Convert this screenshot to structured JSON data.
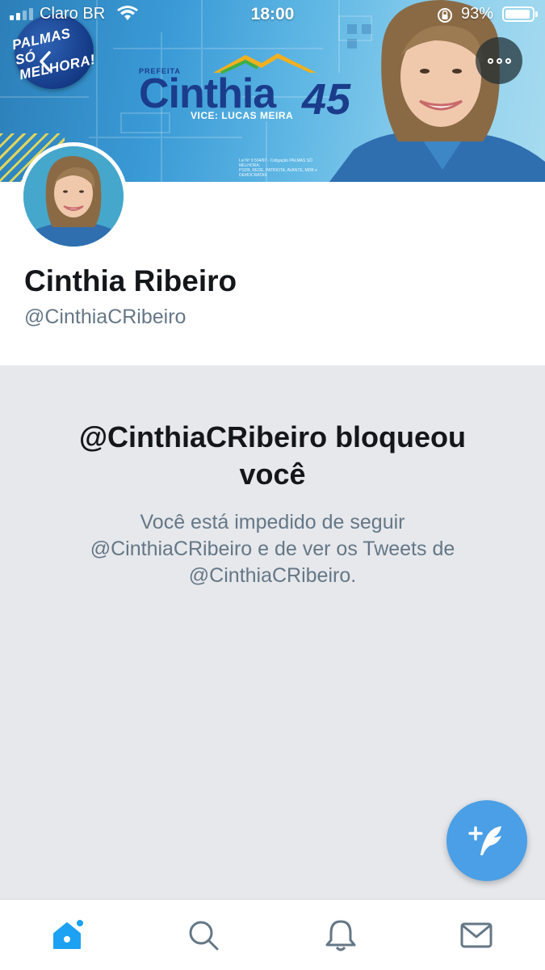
{
  "status_bar": {
    "carrier": "Claro BR",
    "time": "18:00",
    "battery_percent": "93%",
    "battery_level": 0.93
  },
  "banner": {
    "campaign_badge_line1": "PALMAS SÓ",
    "campaign_badge_line2": "MELHORA!",
    "logo_prefix": "PREFEITA",
    "logo_name": "Cinthia",
    "logo_number": "45",
    "logo_vice": "VICE: LUCAS MEIRA",
    "legal_line1": "Lei Nº 9.504/97 - Coligação PALMAS SÓ MELHORA:",
    "legal_line2": "PSDB, REDE, PATRIOTA, AVANTE, MDB e DEMOCRATAS"
  },
  "profile": {
    "display_name": "Cinthia Ribeiro",
    "handle": "@CinthiaCRibeiro"
  },
  "blocked": {
    "title_line1": "@CinthiaCRibeiro bloqueou",
    "title_line2": "você",
    "desc_line1": "Você está impedido de seguir",
    "desc_line2": "@CinthiaCRibeiro e de ver os Tweets de",
    "desc_line3": "@CinthiaCRibeiro."
  },
  "icons": {
    "back": "chevron-left-icon",
    "more": "more-dots-icon",
    "compose": "compose-tweet-icon",
    "tabs": [
      "home-icon",
      "search-icon",
      "notifications-bell-icon",
      "messages-envelope-icon"
    ]
  },
  "colors": {
    "accent": "#1da1f2",
    "compose": "#4a9fe6",
    "panel_bg": "#e6e8ec",
    "muted_text": "#657786",
    "logo_navy": "#1b3c8b"
  },
  "tabs": {
    "active": "home"
  }
}
